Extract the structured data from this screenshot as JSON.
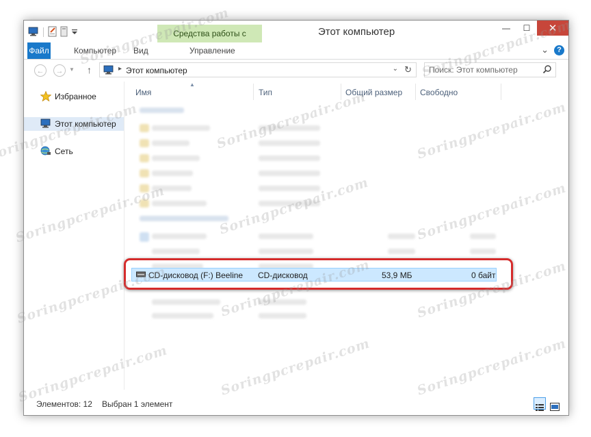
{
  "window": {
    "title": "Этот компьютер",
    "contextual_tab": "Средства работы с дисками",
    "close_glyph": "✕",
    "minimize_glyph": "—",
    "maximize_glyph": "☐"
  },
  "ribbon": {
    "tabs": [
      "Файл",
      "Компьютер",
      "Вид",
      "Управление"
    ],
    "collapse_glyph": "⌄",
    "help_glyph": "?"
  },
  "address": {
    "back_glyph": "←",
    "forward_glyph": "→",
    "up_glyph": "↑",
    "separator": "▸",
    "path": "Этот компьютер",
    "dropdown_glyph": "⌄",
    "refresh_glyph": "↻",
    "search_placeholder": "Поиск: Этот компьютер"
  },
  "navpane": {
    "items": [
      "Избранное",
      "Этот компьютер",
      "Сеть"
    ],
    "selected_index": 1
  },
  "columns": [
    "Имя",
    "Тип",
    "Общий размер",
    "Свободно"
  ],
  "selected_row": {
    "name": "CD-дисковод (F:) Beeline",
    "type": "CD-дисковод",
    "total_size": "53,9 МБ",
    "free": "0 байт"
  },
  "status": {
    "items_count": "Элементов: 12",
    "selected": "Выбран 1 элемент"
  },
  "watermark": "Soringpcrepair.com",
  "colors": {
    "accent": "#1979ca",
    "contextual_tab_bg": "#cfe8b6",
    "close_button": "#c7463a",
    "selection_bg": "#cce8ff",
    "selection_border": "#99d1ff",
    "annotation_frame": "#d52b2b"
  }
}
